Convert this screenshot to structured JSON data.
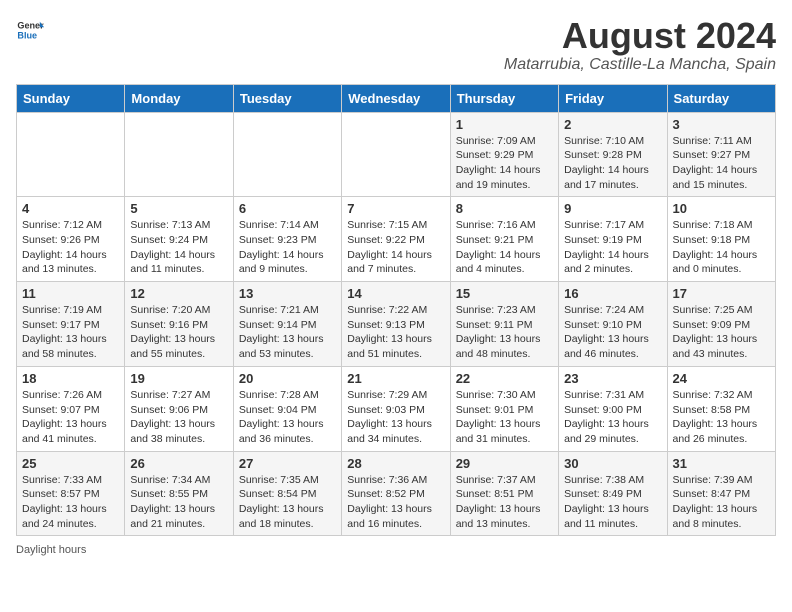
{
  "header": {
    "logo_general": "General",
    "logo_blue": "Blue",
    "title": "August 2024",
    "subtitle": "Matarrubia, Castille-La Mancha, Spain"
  },
  "calendar": {
    "days_of_week": [
      "Sunday",
      "Monday",
      "Tuesday",
      "Wednesday",
      "Thursday",
      "Friday",
      "Saturday"
    ],
    "weeks": [
      [
        {
          "day": "",
          "info": ""
        },
        {
          "day": "",
          "info": ""
        },
        {
          "day": "",
          "info": ""
        },
        {
          "day": "",
          "info": ""
        },
        {
          "day": "1",
          "info": "Sunrise: 7:09 AM\nSunset: 9:29 PM\nDaylight: 14 hours and 19 minutes."
        },
        {
          "day": "2",
          "info": "Sunrise: 7:10 AM\nSunset: 9:28 PM\nDaylight: 14 hours and 17 minutes."
        },
        {
          "day": "3",
          "info": "Sunrise: 7:11 AM\nSunset: 9:27 PM\nDaylight: 14 hours and 15 minutes."
        }
      ],
      [
        {
          "day": "4",
          "info": "Sunrise: 7:12 AM\nSunset: 9:26 PM\nDaylight: 14 hours and 13 minutes."
        },
        {
          "day": "5",
          "info": "Sunrise: 7:13 AM\nSunset: 9:24 PM\nDaylight: 14 hours and 11 minutes."
        },
        {
          "day": "6",
          "info": "Sunrise: 7:14 AM\nSunset: 9:23 PM\nDaylight: 14 hours and 9 minutes."
        },
        {
          "day": "7",
          "info": "Sunrise: 7:15 AM\nSunset: 9:22 PM\nDaylight: 14 hours and 7 minutes."
        },
        {
          "day": "8",
          "info": "Sunrise: 7:16 AM\nSunset: 9:21 PM\nDaylight: 14 hours and 4 minutes."
        },
        {
          "day": "9",
          "info": "Sunrise: 7:17 AM\nSunset: 9:19 PM\nDaylight: 14 hours and 2 minutes."
        },
        {
          "day": "10",
          "info": "Sunrise: 7:18 AM\nSunset: 9:18 PM\nDaylight: 14 hours and 0 minutes."
        }
      ],
      [
        {
          "day": "11",
          "info": "Sunrise: 7:19 AM\nSunset: 9:17 PM\nDaylight: 13 hours and 58 minutes."
        },
        {
          "day": "12",
          "info": "Sunrise: 7:20 AM\nSunset: 9:16 PM\nDaylight: 13 hours and 55 minutes."
        },
        {
          "day": "13",
          "info": "Sunrise: 7:21 AM\nSunset: 9:14 PM\nDaylight: 13 hours and 53 minutes."
        },
        {
          "day": "14",
          "info": "Sunrise: 7:22 AM\nSunset: 9:13 PM\nDaylight: 13 hours and 51 minutes."
        },
        {
          "day": "15",
          "info": "Sunrise: 7:23 AM\nSunset: 9:11 PM\nDaylight: 13 hours and 48 minutes."
        },
        {
          "day": "16",
          "info": "Sunrise: 7:24 AM\nSunset: 9:10 PM\nDaylight: 13 hours and 46 minutes."
        },
        {
          "day": "17",
          "info": "Sunrise: 7:25 AM\nSunset: 9:09 PM\nDaylight: 13 hours and 43 minutes."
        }
      ],
      [
        {
          "day": "18",
          "info": "Sunrise: 7:26 AM\nSunset: 9:07 PM\nDaylight: 13 hours and 41 minutes."
        },
        {
          "day": "19",
          "info": "Sunrise: 7:27 AM\nSunset: 9:06 PM\nDaylight: 13 hours and 38 minutes."
        },
        {
          "day": "20",
          "info": "Sunrise: 7:28 AM\nSunset: 9:04 PM\nDaylight: 13 hours and 36 minutes."
        },
        {
          "day": "21",
          "info": "Sunrise: 7:29 AM\nSunset: 9:03 PM\nDaylight: 13 hours and 34 minutes."
        },
        {
          "day": "22",
          "info": "Sunrise: 7:30 AM\nSunset: 9:01 PM\nDaylight: 13 hours and 31 minutes."
        },
        {
          "day": "23",
          "info": "Sunrise: 7:31 AM\nSunset: 9:00 PM\nDaylight: 13 hours and 29 minutes."
        },
        {
          "day": "24",
          "info": "Sunrise: 7:32 AM\nSunset: 8:58 PM\nDaylight: 13 hours and 26 minutes."
        }
      ],
      [
        {
          "day": "25",
          "info": "Sunrise: 7:33 AM\nSunset: 8:57 PM\nDaylight: 13 hours and 24 minutes."
        },
        {
          "day": "26",
          "info": "Sunrise: 7:34 AM\nSunset: 8:55 PM\nDaylight: 13 hours and 21 minutes."
        },
        {
          "day": "27",
          "info": "Sunrise: 7:35 AM\nSunset: 8:54 PM\nDaylight: 13 hours and 18 minutes."
        },
        {
          "day": "28",
          "info": "Sunrise: 7:36 AM\nSunset: 8:52 PM\nDaylight: 13 hours and 16 minutes."
        },
        {
          "day": "29",
          "info": "Sunrise: 7:37 AM\nSunset: 8:51 PM\nDaylight: 13 hours and 13 minutes."
        },
        {
          "day": "30",
          "info": "Sunrise: 7:38 AM\nSunset: 8:49 PM\nDaylight: 13 hours and 11 minutes."
        },
        {
          "day": "31",
          "info": "Sunrise: 7:39 AM\nSunset: 8:47 PM\nDaylight: 13 hours and 8 minutes."
        }
      ]
    ]
  },
  "footer": {
    "note": "Daylight hours"
  }
}
